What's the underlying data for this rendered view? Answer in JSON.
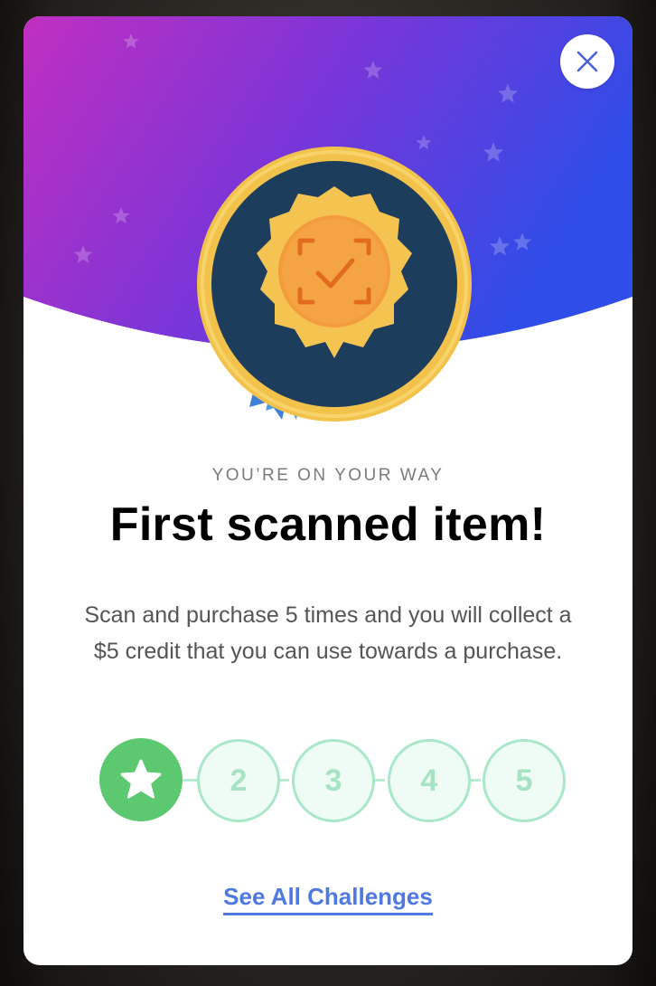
{
  "modal": {
    "eyebrow": "YOU’RE ON YOUR WAY",
    "title": "First scanned item!",
    "description": "Scan and purchase 5 times and you will collect a $5 credit that you can use towards a purchase.",
    "badge_icon": "scan-check-ribbon-badge",
    "close_icon": "close-icon"
  },
  "progress": {
    "completed": 1,
    "total": 5,
    "steps": [
      {
        "label": "",
        "icon": "star-icon",
        "done": true
      },
      {
        "label": "2",
        "done": false
      },
      {
        "label": "3",
        "done": false
      },
      {
        "label": "4",
        "done": false
      },
      {
        "label": "5",
        "done": false
      }
    ]
  },
  "link": {
    "label": "See All Challenges"
  },
  "colors": {
    "hero_gradient_start": "#c02fc0",
    "hero_gradient_mid": "#7b35d8",
    "hero_gradient_end": "#2f4de8",
    "step_done": "#5cc870",
    "step_pending_border": "#a8e8c8",
    "link": "#4f79e0"
  }
}
